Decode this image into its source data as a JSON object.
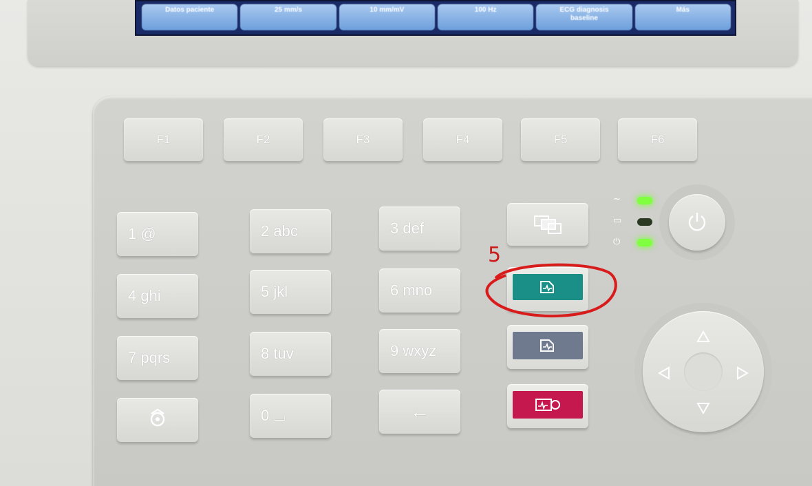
{
  "screen": {
    "softkeys": [
      {
        "label": "Datos paciente"
      },
      {
        "label": "25 mm/s"
      },
      {
        "label": "10 mm/mV"
      },
      {
        "label": "100 Hz"
      },
      {
        "label": "ECG diagnosis\nbaseline"
      },
      {
        "label": "Más"
      }
    ]
  },
  "function_keys": [
    {
      "label": "F1"
    },
    {
      "label": "F2"
    },
    {
      "label": "F3"
    },
    {
      "label": "F4"
    },
    {
      "label": "F5"
    },
    {
      "label": "F6"
    }
  ],
  "numeric_keys": [
    {
      "label": "1 @"
    },
    {
      "label": "2 abc"
    },
    {
      "label": "3 def"
    },
    {
      "label": "4 ghi"
    },
    {
      "label": "5 jkl"
    },
    {
      "label": "6 mno"
    },
    {
      "label": "7 pqrs"
    },
    {
      "label": "8 tuv"
    },
    {
      "label": "9 wxyz"
    }
  ],
  "bottom_keys": {
    "zero_label": "0 ⌴",
    "back_label": "←",
    "special_icon": "shift-rotate-icon"
  },
  "right_column": {
    "copy_icon": "copy-documents-icon",
    "teal_icon": "ecg-auto-icon",
    "slate_icon": "ecg-manual-icon",
    "red_icon": "ecg-stop-icon"
  },
  "indicators": [
    {
      "symbol": "~",
      "state": "on",
      "color": "#7fff3f"
    },
    {
      "symbol": "▭",
      "state": "off",
      "color": "#2a3a22"
    },
    {
      "symbol": "⏻",
      "state": "on",
      "color": "#7fff3f"
    }
  ],
  "power_icon": "power-icon",
  "nav_icons": [
    "arrow-up-icon",
    "arrow-left-icon",
    "arrow-right-icon",
    "arrow-down-icon"
  ],
  "annotation": {
    "label": "5",
    "color": "#cc1a1a"
  },
  "colors": {
    "teal_button": "#1a8f88",
    "slate_button": "#6f7a8e",
    "red_button": "#c4184f",
    "screen_background": "#1a2a66"
  }
}
